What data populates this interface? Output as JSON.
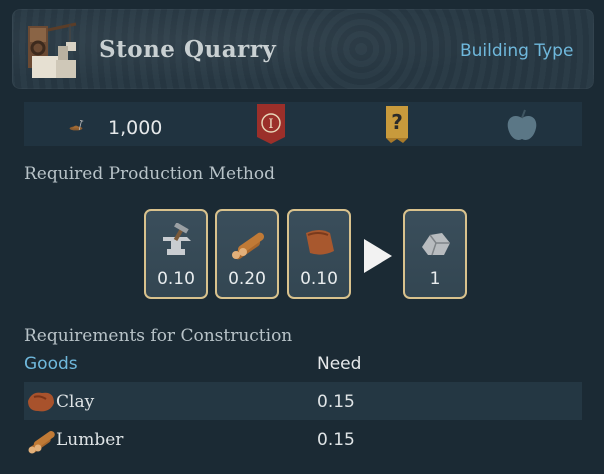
{
  "header": {
    "title": "Stone Quarry",
    "type_link": "Building Type",
    "icon": "stone-quarry-building-icon"
  },
  "info_bar": {
    "cost": "1,000",
    "cost_icon": "workforce-farmer-icon",
    "badge_icon": "tier-one-banner-icon",
    "badge_text": "I",
    "unknown_icon": "question-scroll-icon",
    "apple_icon": "apple-icon"
  },
  "production": {
    "label": "Required Production Method",
    "inputs": [
      {
        "icon": "anvil-tools-icon",
        "value": "0.10"
      },
      {
        "icon": "lumber-logs-icon",
        "value": "0.20"
      },
      {
        "icon": "leather-icon",
        "value": "0.10"
      }
    ],
    "output": {
      "icon": "stone-icon",
      "value": "1"
    }
  },
  "construction": {
    "label": "Requirements for Construction",
    "col_goods": "Goods",
    "col_need": "Need",
    "rows": [
      {
        "icon": "clay-icon",
        "name": "Clay",
        "need": "0.15"
      },
      {
        "icon": "lumber-icon",
        "name": "Lumber",
        "need": "0.15"
      }
    ]
  },
  "colors": {
    "accent": "#6fb8dc",
    "tile_border": "#d9c28d",
    "badge": "#9b2f2a"
  }
}
